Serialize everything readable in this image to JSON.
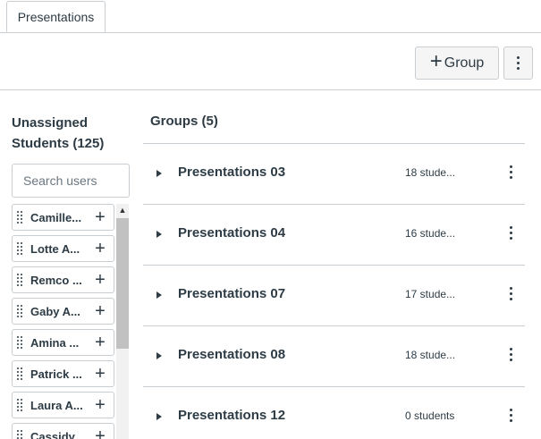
{
  "tabs": {
    "active_label": "Presentations"
  },
  "toolbar": {
    "group_label": "Group"
  },
  "unassigned": {
    "title": "Unassigned Students (125)",
    "search_placeholder": "Search users",
    "students": [
      {
        "label": "Camille..."
      },
      {
        "label": "Lotte A..."
      },
      {
        "label": "Remco ..."
      },
      {
        "label": "Gaby A..."
      },
      {
        "label": "Amina ..."
      },
      {
        "label": "Patrick ..."
      },
      {
        "label": "Laura A..."
      },
      {
        "label": "Cassidy..."
      }
    ]
  },
  "groups": {
    "title": "Groups (5)",
    "items": [
      {
        "name": "Presentations 03",
        "count": "18 stude..."
      },
      {
        "name": "Presentations 04",
        "count": "16 stude..."
      },
      {
        "name": "Presentations 07",
        "count": "17 stude..."
      },
      {
        "name": "Presentations 08",
        "count": "18 stude..."
      },
      {
        "name": "Presentations 12",
        "count": "0 students"
      }
    ]
  },
  "icons": {
    "add_group": "plus-icon",
    "options": "kebab-menu-icon",
    "drag": "drag-handle-icon",
    "expand": "caret-right-icon"
  }
}
